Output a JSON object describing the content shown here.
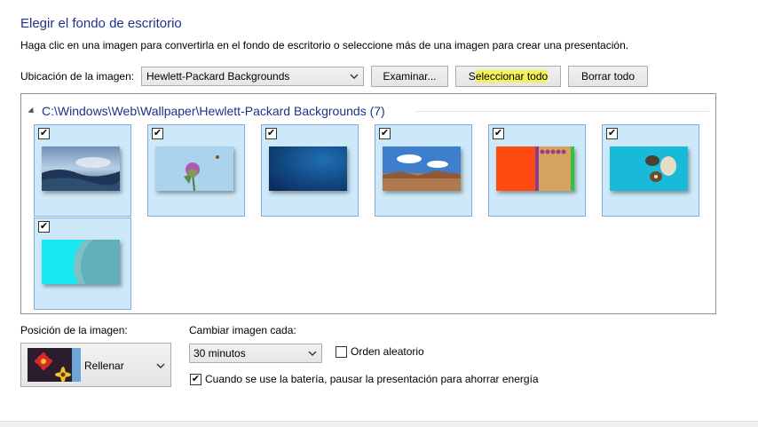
{
  "header": {
    "title": "Elegir el fondo de escritorio",
    "description": "Haga clic en una imagen para convertirla en el fondo de escritorio o seleccione más de una imagen para crear una presentación."
  },
  "location": {
    "label": "Ubicación de la imagen:",
    "value": "Hewlett-Packard Backgrounds",
    "browse_label": "Examinar...",
    "select_all_prefix": "S",
    "select_all_highlight": "eleccionar todo",
    "clear_all_label": "Borrar todo"
  },
  "gallery": {
    "group_title": "C:\\Windows\\Web\\Wallpaper\\Hewlett-Packard Backgrounds (7)",
    "items": [
      {
        "name": "wallpaper-coast",
        "checked": true
      },
      {
        "name": "wallpaper-thistle",
        "checked": true
      },
      {
        "name": "wallpaper-blue",
        "checked": true
      },
      {
        "name": "wallpaper-desert",
        "checked": true
      },
      {
        "name": "wallpaper-matches",
        "checked": true
      },
      {
        "name": "wallpaper-stones",
        "checked": true
      },
      {
        "name": "wallpaper-pool",
        "checked": true
      }
    ]
  },
  "position": {
    "label": "Posición de la imagen:",
    "value": "Rellenar"
  },
  "interval": {
    "label": "Cambiar imagen cada:",
    "value": "30 minutos"
  },
  "shuffle": {
    "label": "Orden aleatorio",
    "checked": false
  },
  "battery": {
    "label": "Cuando se use la batería, pausar la presentación para ahorrar energía",
    "checked": true
  },
  "colors": {
    "accent": "#1e3287",
    "thumb_selected_bg": "#cde8f8",
    "thumb_selected_border": "#84acdd",
    "highlight": "#f5f25a"
  },
  "icons": {
    "checkmark": "check-icon",
    "dropdown": "chevron-down-icon",
    "collapse": "collapse-triangle-icon"
  }
}
